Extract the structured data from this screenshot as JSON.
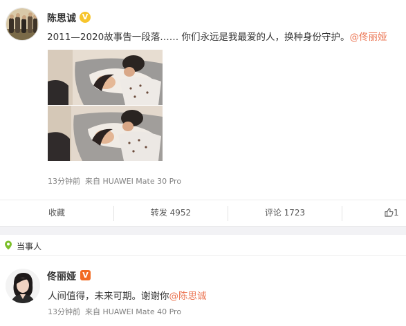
{
  "post1": {
    "author": "陈思诚",
    "text": "2011—2020故事告一段落……  你们永远是我最爱的人，换种身份守护。",
    "mention": "@佟丽娅",
    "time": "13分钟前",
    "source": "来自 HUAWEI Mate 30 Pro",
    "actions": {
      "favorite": "收藏",
      "repost": "转发 4952",
      "comment": "评论 1723",
      "like": "1"
    }
  },
  "tag_bar": {
    "label": "当事人",
    "icon": "location-pin-icon"
  },
  "post2": {
    "author": "佟丽娅",
    "text": "人间值得，未来可期。谢谢你",
    "mention": "@陈思诚",
    "time": "13分钟前",
    "source": "来自 HUAWEI Mate 40 Pro"
  },
  "colors": {
    "mention": "#eb7350",
    "verified_yellow": "#f7c52c",
    "verified_orange": "#f26a22",
    "meta_gray": "#808080",
    "tag_icon_green": "#7cbf2a"
  }
}
